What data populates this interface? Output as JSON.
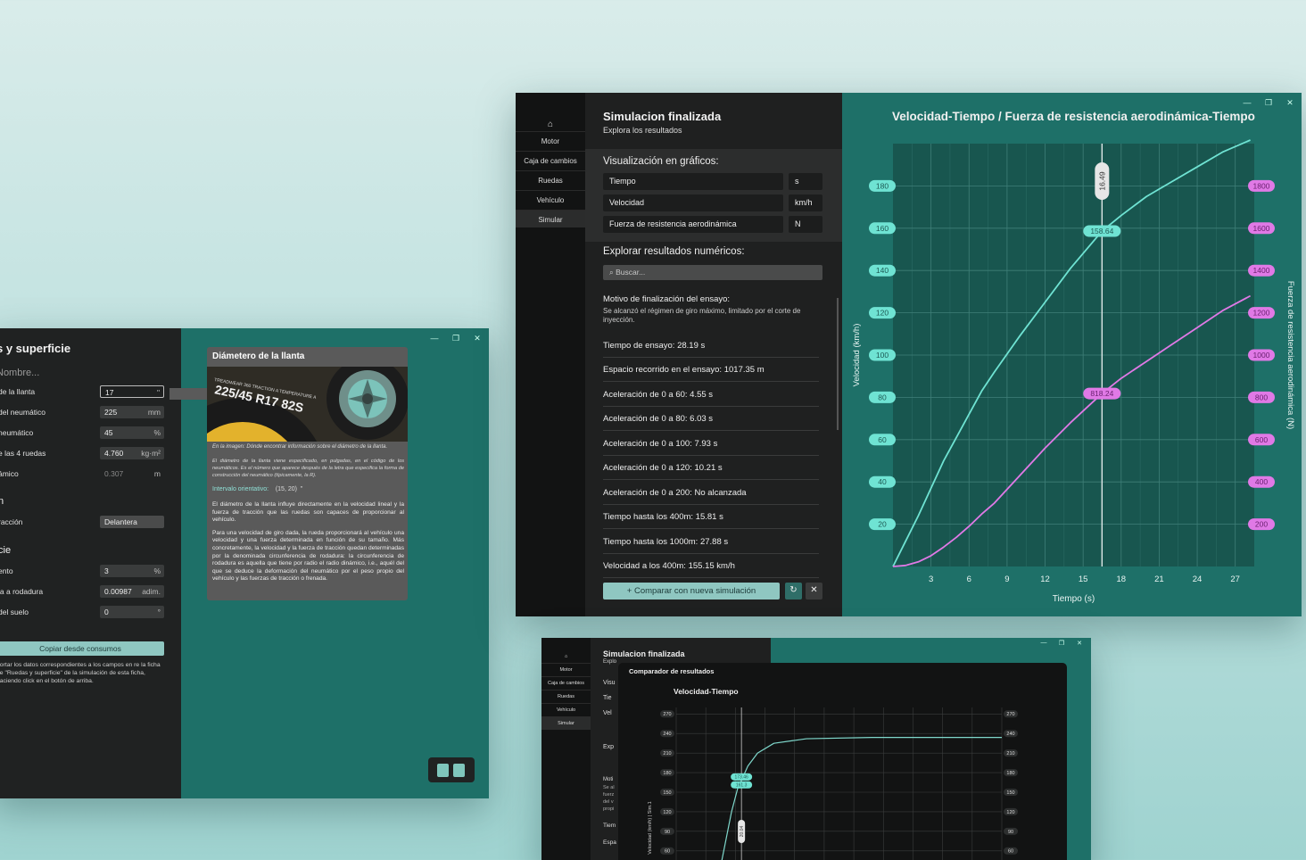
{
  "window1": {
    "title": "s y superficie",
    "name_placeholder": "Nombre...",
    "fields": [
      {
        "label": "de la llanta",
        "value": "17",
        "unit": "\""
      },
      {
        "label": "del neumático",
        "value": "225",
        "unit": "mm"
      },
      {
        "label": "neumático",
        "value": "45",
        "unit": "%"
      },
      {
        "label": "e las 4 ruedas",
        "value": "4.760",
        "unit": "kg·m²"
      },
      {
        "label": "ámico",
        "value": "0.307",
        "unit": "m"
      }
    ],
    "section_n": "n",
    "traccion_label": "racción",
    "traccion_value": "Delantera",
    "section_cie": "cie",
    "fields2": [
      {
        "label": "ento",
        "value": "3",
        "unit": "%"
      },
      {
        "label": "ia a rodadura",
        "value": "0.00987",
        "unit": "adim."
      },
      {
        "label": "del suelo",
        "value": "0",
        "unit": "°"
      }
    ],
    "copy_button": "Copiar desde consumos",
    "copy_note": "portar los datos correspondientes a los campos en re la ficha de \"Ruedas y superficie\" de la simulación de esta ficha, haciendo click en el botón de arriba.",
    "tooltip": {
      "title": "Diámetero de la llanta",
      "tire_code": "225/45 R17 82S",
      "tire_small": "TREADWEAR 360 TRACTION A TEMPERATURE A",
      "caption": "En la imagen: Dónde encontrar información sobre el diámetro de la llanta.",
      "desc": "El diámetro de la llanta viene especificado, en pulgadas, en el código de los neumáticos. Es el número que aparece después de la letra que especifica la forma de construcción del neumático (típicamente, la R).",
      "interval_label": "Intervalo orientativo:",
      "interval_value": "(15, 20)",
      "interval_unit": "\"",
      "body1": "El diámetro de la llanta influye directamente en la velocidad lineal y la fuerza de tracción que las ruedas son capaces de proporcionar al vehículo.",
      "body2": "Para una velocidad de giro dada, la rueda proporcionará al vehículo una velocidad y una fuerza determinada en función de su tamaño. Más concretamente, la velocidad y la fuerza de tracción quedan determinadas por la denominada circunferencia de rodadura: la circunferencia de rodadura es aquella que tiene por radio el radio dinámico, i.e., aquél del que se deduce la deformación del neumático por el peso propio del vehículo y las fuerzas de tracción o frenada."
    }
  },
  "window2": {
    "nav": [
      "Motor",
      "Caja de cambios",
      "Ruedas",
      "Vehículo",
      "Simular"
    ],
    "title": "Simulacion finalizada",
    "subtitle": "Explora los resultados",
    "vis_label": "Visualización en gráficos:",
    "vis_rows": [
      {
        "name": "Tiempo",
        "unit": "s"
      },
      {
        "name": "Velocidad",
        "unit": "km/h"
      },
      {
        "name": "Fuerza de resistencia aerodinámica",
        "unit": "N"
      }
    ],
    "explore_label": "Explorar resultados numéricos:",
    "search_placeholder": "⌕ Buscar...",
    "motivo_title": "Motivo de finalización del ensayo:",
    "motivo_text": "Se alcanzó el régimen de giro máximo, limitado por el corte de inyección.",
    "results": [
      "Tiempo de ensayo: 28.19 s",
      "Espacio recorrido en el ensayo: 1017.35 m",
      "Aceleración de 0 a 60: 4.55 s",
      "Aceleración de 0 a 80: 6.03 s",
      "Aceleración de 0 a 100: 7.93 s",
      "Aceleración de 0 a 120: 10.21 s",
      "Aceleración de 0 a 200: No alcanzada",
      "Tiempo hasta los 400m: 15.81 s",
      "Tiempo hasta los 1000m: 27.88 s",
      "Velocidad a los 400m: 155.15 km/h"
    ],
    "compare_button": "+ Comparar con nueva simulación",
    "refresh_icon": "↻",
    "close_icon": "✕",
    "chart_title": "Velocidad-Tiempo / Fuerza de resistencia aerodinámica-Tiempo"
  },
  "window3": {
    "nav": [
      "Motor",
      "Caja de cambios",
      "Ruedas",
      "Vehículo",
      "Simular"
    ],
    "title": "Simulacion finalizada",
    "subtitle": "Explo",
    "ghost_labels": [
      "Visu",
      "Tie",
      "Vel",
      "Exp",
      "Moti",
      "Se al",
      "fuerz",
      "del v",
      "propi",
      "Tiem",
      "Espa"
    ],
    "modal_title": "Comparador de resultados",
    "chart_title": "Velocidad-Tiempo"
  },
  "chart_data": [
    {
      "type": "line",
      "title": "Velocidad-Tiempo / Fuerza de resistencia aerodinámica-Tiempo",
      "xlabel": "Tiempo (s)",
      "ylabel": "Velocidad (km/h)",
      "y2label": "Fuerza de resistencia aerodinámica (N)",
      "xlim": [
        0,
        28.5
      ],
      "ylim": [
        0,
        200
      ],
      "y2lim": [
        0,
        2000
      ],
      "xticks": [
        3,
        6,
        9,
        12,
        15,
        18,
        21,
        24,
        27
      ],
      "yticks": [
        20,
        40,
        60,
        80,
        100,
        120,
        140,
        160,
        180
      ],
      "y2ticks": [
        200,
        400,
        600,
        800,
        1000,
        1200,
        1400,
        1600,
        1800
      ],
      "grid": true,
      "cursor": {
        "x": 16.49,
        "y": 158.64,
        "y2": 818.24
      },
      "series": [
        {
          "name": "Velocidad",
          "axis": "left",
          "color": "#6fe3d3",
          "x": [
            0,
            1,
            2,
            3,
            4,
            5,
            6,
            7,
            8,
            10,
            12,
            14,
            16.49,
            18,
            20,
            22,
            24,
            26,
            28.19
          ],
          "y": [
            0,
            12,
            24,
            37,
            50,
            61,
            72,
            83,
            92,
            109,
            125,
            141,
            158.64,
            166,
            175,
            182,
            189,
            196,
            203
          ]
        },
        {
          "name": "Fuerza de resistencia aerodinámica",
          "axis": "right",
          "color": "#e079e6",
          "x": [
            0,
            1,
            2,
            3,
            4,
            5,
            6,
            7,
            8,
            10,
            12,
            14,
            16.49,
            18,
            20,
            22,
            24,
            26,
            28.19
          ],
          "y": [
            0,
            5,
            22,
            51,
            92,
            138,
            190,
            248,
            300,
            430,
            560,
            680,
            818.24,
            890,
            970,
            1050,
            1130,
            1210,
            1280
          ]
        }
      ]
    },
    {
      "type": "line",
      "title": "Velocidad-Tiempo",
      "ylabel": "Velocidad (km/h) | Sim.1",
      "ylim": [
        20,
        280
      ],
      "yticks": [
        30,
        60,
        90,
        120,
        150,
        180,
        210,
        240,
        270
      ],
      "grid": true,
      "cursor": {
        "x": 20.04,
        "values": [
          173.46,
          161.3
        ]
      },
      "series": [
        {
          "name": "",
          "color": "#7fd8cc",
          "x": [
            13,
            15,
            17,
            19,
            20.04,
            22,
            25,
            30,
            40,
            60,
            80,
            100
          ],
          "y": [
            20,
            70,
            120,
            158,
            168,
            190,
            210,
            225,
            232,
            234,
            234,
            234
          ]
        }
      ]
    }
  ]
}
